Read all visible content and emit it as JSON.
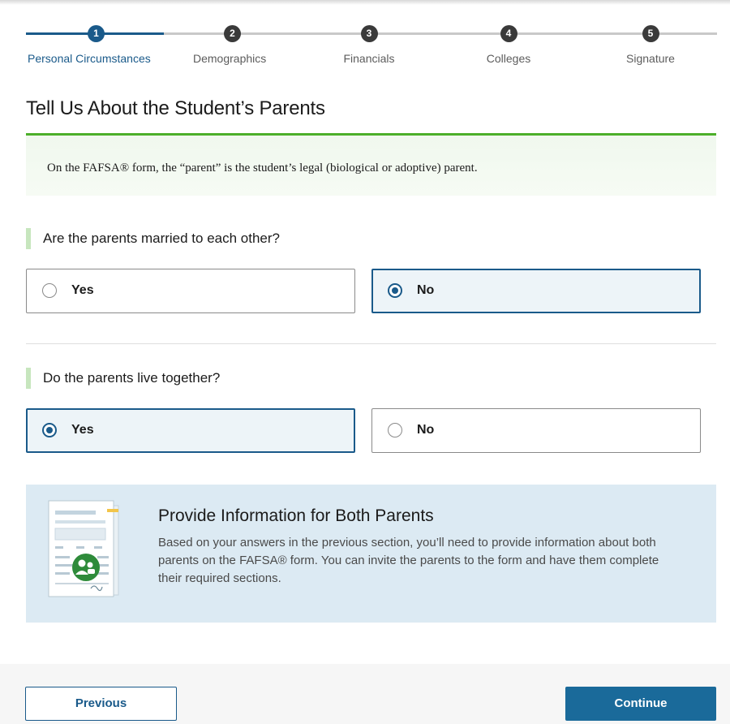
{
  "stepper": {
    "steps": [
      {
        "num": "1",
        "label": "Personal Circumstances"
      },
      {
        "num": "2",
        "label": "Demographics"
      },
      {
        "num": "3",
        "label": "Financials"
      },
      {
        "num": "4",
        "label": "Colleges"
      },
      {
        "num": "5",
        "label": "Signature"
      }
    ],
    "active_step": 1
  },
  "page": {
    "title": "Tell Us About the Student’s Parents",
    "note": "On the FAFSA® form, the “parent” is the student’s legal (biological or adoptive) parent."
  },
  "questions": [
    {
      "label": "Are the parents married to each other?",
      "options": [
        "Yes",
        "No"
      ],
      "selected": "No"
    },
    {
      "label": "Do the parents live together?",
      "options": [
        "Yes",
        "No"
      ],
      "selected": "Yes"
    }
  ],
  "info": {
    "title": "Provide Information for Both Parents",
    "body": "Based on your answers in the previous section, you’ll need to provide information about both parents on the FAFSA® form. You can invite the parents to the form and have them complete their required sections."
  },
  "footer": {
    "previous_label": "Previous",
    "continue_label": "Continue"
  },
  "colors": {
    "primary": "#1a5a8a",
    "success": "#4caf2a",
    "info_bg": "#dceaf3"
  }
}
